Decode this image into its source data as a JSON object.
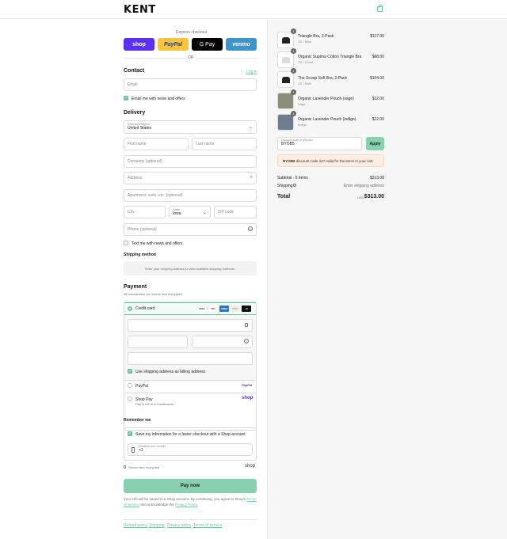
{
  "brand": {
    "logo": "KENT"
  },
  "express": {
    "label": "Express checkout",
    "or": "OR",
    "buttons": [
      "shop",
      "PayPal",
      "G Pay",
      "venmo"
    ],
    "colors": {
      "shop": "#5a31f4",
      "paypal": "#ffc439",
      "gpay": "#000000",
      "venmo": "#3d95ce"
    }
  },
  "contact": {
    "title": "Contact",
    "login": "Log in",
    "email_placeholder": "Email",
    "news_label": "Email me with news and offers"
  },
  "delivery": {
    "title": "Delivery",
    "country_label": "Country/Region",
    "country_value": "United States",
    "first_name": "First name",
    "last_name": "Last name",
    "company": "Company (optional)",
    "address": "Address",
    "apartment": "Apartment, suite, etc. (optional)",
    "city": "City",
    "state_label": "State",
    "state_value": "Iowa",
    "zip": "ZIP code",
    "phone": "Phone (optional)",
    "text_label": "Text me with news and offers"
  },
  "shipping": {
    "title": "Shipping method",
    "notice": "Enter your shipping address to view available shipping methods."
  },
  "payment": {
    "title": "Payment",
    "subtitle": "All transactions are secure and encrypted.",
    "credit_label": "Credit card",
    "cards": [
      "VISA",
      "MC",
      "AMEX",
      "DISC",
      "+3"
    ],
    "billing_label": "Use shipping address as billing address",
    "paypal_label": "PayPal",
    "paypal_logo": "PayPal",
    "shoppay_label": "Shop Pay",
    "shoppay_sub": "Pay in full or in installments",
    "shoppay_logo": "shop"
  },
  "remember": {
    "title": "Remember me",
    "save_label": "Save my information for a faster checkout with a Shop account",
    "phone_label": "Mobile phone number",
    "phone_prefix": "+1",
    "secure": "Secure and encrypted",
    "shop_logo": "shop"
  },
  "pay_button": "Pay now",
  "legal": {
    "text1": "Your info will be saved to a Shop account. By continuing, you agree to Shop's",
    "terms": "Terms of Service",
    "text2": "and acknowledge the",
    "privacy": "Privacy Policy",
    "end": "."
  },
  "footer": [
    "Refund policy",
    "Shipping",
    "Privacy policy",
    "Terms of service"
  ],
  "cart": {
    "items": [
      {
        "qty": "1",
        "name": "Triangle Bra, 2-Pack",
        "variant": "XS / Multi",
        "price": "$117.00"
      },
      {
        "qty": "1",
        "name": "Organic Supima Cotton Triangle Bra",
        "variant": "XS / Cloud",
        "price": "$68.00"
      },
      {
        "qty": "1",
        "name": "The Scoop Soft Bra, 2-Pack",
        "variant": "XS / Multi",
        "price": "$104.00"
      },
      {
        "qty": "1",
        "name": "Organic Lavender Pouch (sage)",
        "variant": "Sage",
        "price": "$12.00"
      },
      {
        "qty": "1",
        "name": "Organic Lavender Pouch (indigo)",
        "variant": "Indigo",
        "price": "$12.00"
      }
    ],
    "discount_label": "Discount code or gift card",
    "discount_value": "BYOB5",
    "apply": "Apply",
    "error_code": "BYOB5",
    "error_text": "discount code isn't valid for the items in your cart",
    "subtotal_label": "Subtotal · 5 items",
    "subtotal": "$313.00",
    "shipping_label": "Shipping",
    "shipping_value": "Enter shipping address",
    "total_label": "Total",
    "currency": "USD",
    "total": "$313.00"
  }
}
